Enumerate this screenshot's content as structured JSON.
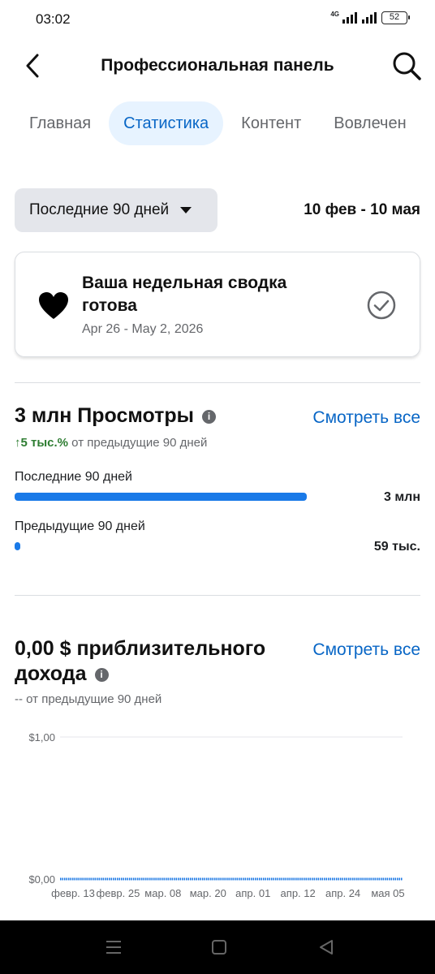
{
  "status_bar": {
    "time": "03:02",
    "network": "4G",
    "battery": "52"
  },
  "header": {
    "title": "Профессиональная панель"
  },
  "tabs": [
    {
      "label": "Главная",
      "active": false
    },
    {
      "label": "Статистика",
      "active": true
    },
    {
      "label": "Контент",
      "active": false
    },
    {
      "label": "Вовлечен",
      "active": false
    }
  ],
  "filter": {
    "label": "Последние 90 дней",
    "range": "10 фев - 10 мая"
  },
  "summary": {
    "title": "Ваша недельная сводка готова",
    "date": "Apr 26 - May 2, 2026"
  },
  "views": {
    "title": "3 млн Просмотры",
    "see_all": "Смотреть все",
    "change_arrow": "↑",
    "change_value": "5 тыс.%",
    "change_suffix": " от предыдущие 90 дней",
    "bars": [
      {
        "label": "Последние 90 дней",
        "value": "3 млн",
        "fraction": 1.0
      },
      {
        "label": "Предыдущие 90 дней",
        "value": "59 тыс.",
        "fraction": 0.0197
      }
    ],
    "accent_color": "#1a7ae8"
  },
  "revenue": {
    "title": "0,00 $ приблизительного дохода",
    "see_all": "Смотреть все",
    "subline": "-- от предыдущие 90 дней"
  },
  "chart_data": {
    "type": "line",
    "title": "",
    "xlabel": "",
    "ylabel": "",
    "ylim": [
      0,
      1
    ],
    "y_ticks": [
      "$1,00",
      "$0,00"
    ],
    "categories": [
      "февр. 13",
      "февр. 25",
      "мар. 08",
      "мар. 20",
      "апр. 01",
      "апр. 12",
      "апр. 24",
      "мая 05"
    ],
    "series": [
      {
        "values": [
          0,
          0,
          0,
          0,
          0,
          0,
          0,
          0
        ]
      }
    ],
    "grid": true,
    "line_color": "#1a7ae8"
  },
  "nav": {
    "menu": "menu-icon",
    "home": "home-icon",
    "back": "back-triangle-icon"
  }
}
